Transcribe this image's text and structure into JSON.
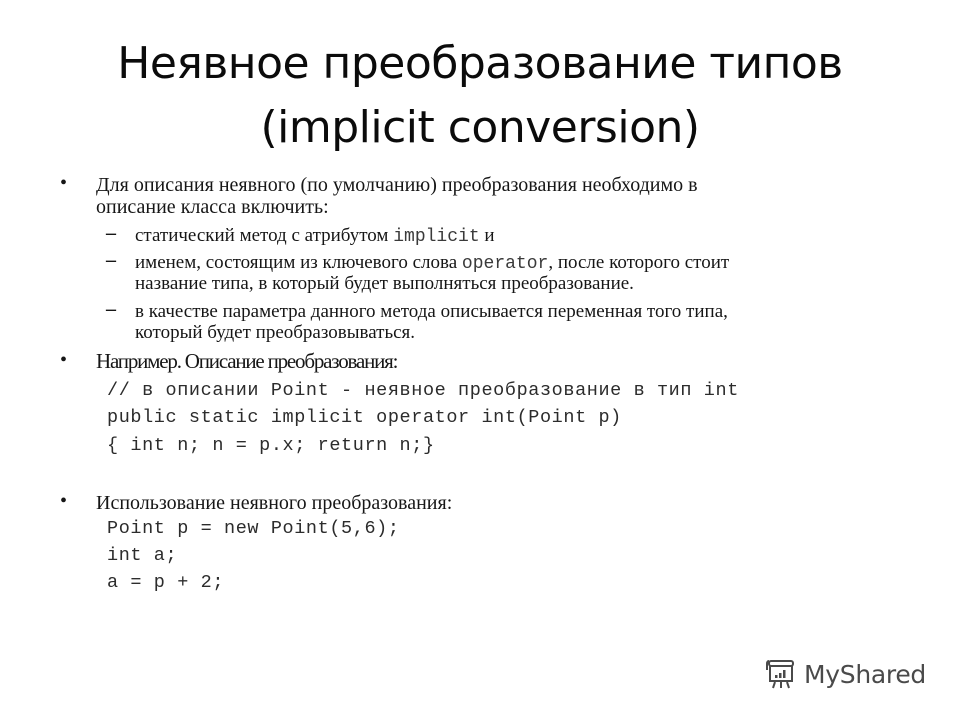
{
  "slide": {
    "title_lines": [
      "Неявное преобразование типов",
      "(implicit conversion)"
    ],
    "bullets": [
      {
        "lines": [
          "Для описания неявного (по умолчанию) преобразования необходимо в",
          "описание класса включить:"
        ],
        "sub_items": [
          {
            "text_before": "статический метод с атрибутом ",
            "code": "implicit",
            "text_after": " и"
          },
          {
            "text_before": "именем, состоящим из ключевого слова ",
            "code": "operator",
            "text_after": ", после которого стоит",
            "line2": "название типа, в который будет выполняться преобразование."
          },
          {
            "line1": "в качестве параметра данного метода описывается переменная того типа,",
            "line2": "который будет преобразовываться."
          }
        ]
      },
      {
        "text": "Например. Описание преобразования:",
        "code_lines": [
          "// в описании Point - неявное преобразование в тип int",
          "public static implicit operator int(Point p)",
          "{ int n; n = p.x; return n;}"
        ]
      },
      {
        "text": "Использование неявного преобразования:",
        "code_lines": [
          "Point p = new Point(5,6);",
          "int a;",
          "a = p + 2;"
        ]
      }
    ]
  },
  "watermark": {
    "icon": "presentation-board-icon",
    "text": "MyShared"
  }
}
